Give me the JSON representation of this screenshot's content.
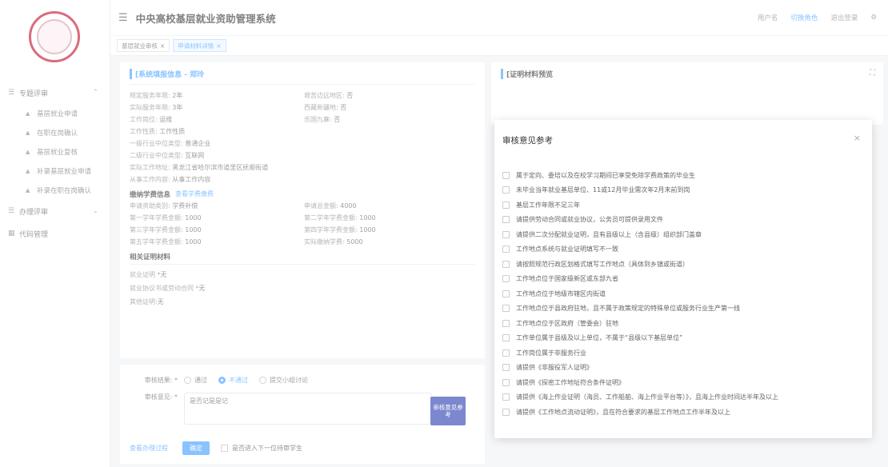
{
  "app": {
    "title": "中央高校基层就业资助管理系统"
  },
  "header": {
    "link1": "用户名",
    "role_switch": "切换角色",
    "logout": "退出登录"
  },
  "tags": [
    {
      "label": "基层就业审核"
    },
    {
      "label": "申请材料详情"
    }
  ],
  "sidebar": {
    "group1": "专题评审",
    "items": [
      {
        "label": "基层就业申请"
      },
      {
        "label": "在职在岗确认"
      },
      {
        "label": "基层就业复核"
      },
      {
        "label": "补录基层就业申请"
      },
      {
        "label": "补录在职在岗确认"
      }
    ],
    "group2": "办理评审",
    "group3": "代码管理"
  },
  "info": {
    "title": "[系统填报信息 - 郑玲",
    "rows": [
      [
        {
          "label": "规定服务年限:",
          "value": "2年"
        },
        {
          "label": "艰苦边远地区:",
          "value": "否"
        }
      ],
      [
        {
          "label": "实际服务年限:",
          "value": "3年"
        },
        {
          "label": "西藏新疆地:",
          "value": "否"
        }
      ],
      [
        {
          "label": "工作岗位:",
          "value": "运维"
        },
        {
          "label": "乐国九寨:",
          "value": "否"
        }
      ],
      [
        {
          "label": "工作性质:",
          "value": "工作性质"
        },
        {
          "label": "",
          "value": ""
        }
      ],
      [
        {
          "label": "一级行业中位类型:",
          "value": "普通企业"
        },
        {
          "label": "",
          "value": ""
        }
      ],
      [
        {
          "label": "二级行业中位类型:",
          "value": "互联网"
        },
        {
          "label": "",
          "value": ""
        }
      ],
      [
        {
          "label": "实际工作地址:",
          "value": "黑龙江省哈尔滨市道里区抚顺街道"
        },
        {
          "label": "",
          "value": ""
        }
      ],
      [
        {
          "label": "从事工作内容:",
          "value": "从事工作内容"
        },
        {
          "label": "",
          "value": ""
        }
      ]
    ],
    "fee_head": "缴纳学费信息",
    "fee_link": "查看学费缴费",
    "fee_rows": [
      [
        {
          "label": "申请资助类别:",
          "value": "学费补偿"
        },
        {
          "label": "申请总金额:",
          "value": "4000"
        }
      ],
      [
        {
          "label": "第一学年学费金额:",
          "value": "1000"
        },
        {
          "label": "第二学年学费金额:",
          "value": "1000"
        }
      ],
      [
        {
          "label": "第三学年学费金额:",
          "value": "1000"
        },
        {
          "label": "第四学年学费金额:",
          "value": "1000"
        }
      ],
      [
        {
          "label": "第五学年学费金额:",
          "value": "1000"
        },
        {
          "label": "实际缴纳学费:",
          "value": "5000"
        }
      ]
    ],
    "proof_head": "相关证明材料",
    "proof_rows": [
      {
        "label": "就业证明 *",
        "value": "无"
      },
      {
        "label": "就业协议书或劳动合同 *",
        "value": "无"
      },
      {
        "label": "其他证明:",
        "value": "无"
      }
    ]
  },
  "material": {
    "title": "[证明材料预览"
  },
  "review": {
    "result_label": "审核结果: *",
    "options": [
      "通过",
      "不通过",
      "提交小组讨论"
    ],
    "opinion_label": "审核意见: *",
    "opinion_value": "是否记是是记",
    "ref_button": "审核意见参考",
    "history_link": "查看办理过程",
    "confirm": "确定",
    "next_check": "是否进入下一位待审学生"
  },
  "modal": {
    "title": "审核意见参考",
    "close": "×",
    "options": [
      "属于定向、委培以及在校学习期间已享受免除学费政策的毕业生",
      "未毕业当年就业基层单位、11或12月毕业需次年2月末前到岗",
      "基层工作年限不足三年",
      "请提供劳动合同或就业协议，公务员可提供录用文件",
      "请提供二次分配就业证明，且有县级以上（含县级）组织部门盖章",
      "工作地点系统与就业证明填写不一致",
      "请按照规范行政区划格式填写工作地点（具体到乡镇或街道）",
      "工作地点位于国家级新区或东部九省",
      "工作地点位于地级市辖区内街道",
      "工作地点位于县政府驻地，且不属于政策规定的特殊单位或服务行业生产第一线",
      "工作地点位于区政府（管委会）驻地",
      "工作单位属于县级及以上单位，不属于“县级以下基层单位”",
      "工作岗位属于非服务行业",
      "请提供《非服役军人证明》",
      "请提供《探密工作地址符合条件证明》",
      "请提供《海上作业证明（海员、工作船舶、海上作业平台等）》，且海上作业时间达半年及以上",
      "请提供《工作地点流动证明》，且在符合要求的基层工作地点工作半年及以上"
    ]
  }
}
